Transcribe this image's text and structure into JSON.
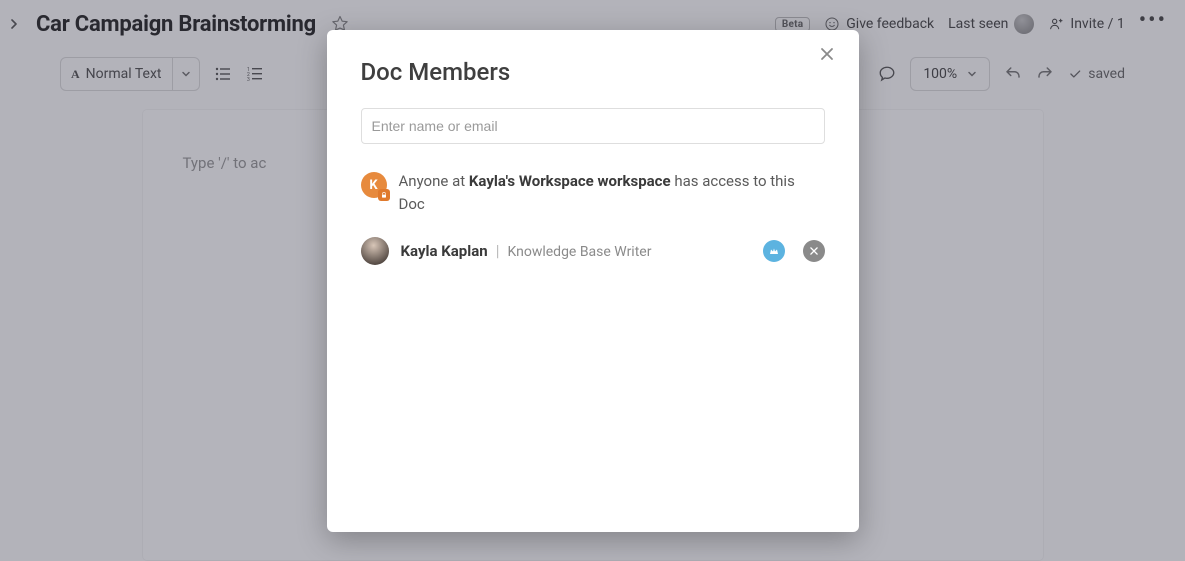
{
  "header": {
    "doc_title": "Car Campaign Brainstorming",
    "beta_label": "Beta",
    "give_feedback": "Give feedback",
    "last_seen": "Last seen",
    "invite_label": "Invite / 1"
  },
  "toolbar": {
    "text_style": "Normal Text",
    "zoom": "100%",
    "saved": "saved"
  },
  "doc": {
    "slash_hint": "Type '/' to ac"
  },
  "modal": {
    "title": "Doc Members",
    "input_placeholder": "Enter name or email",
    "workspace_avatar_letter": "K",
    "workspace_prefix": "Anyone at ",
    "workspace_name": "Kayla's Workspace workspace",
    "workspace_suffix": " has access to this Doc",
    "member_name": "Kayla Kaplan",
    "member_role": "Knowledge Base Writer"
  }
}
